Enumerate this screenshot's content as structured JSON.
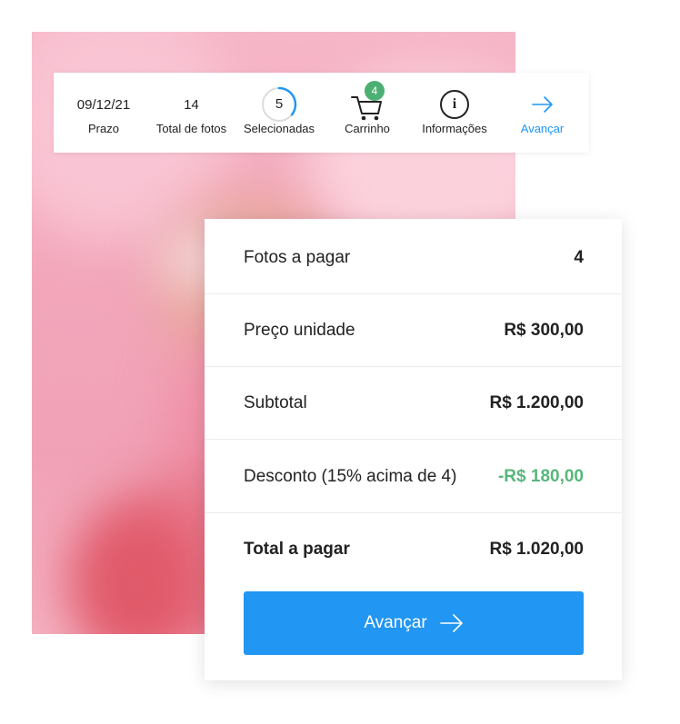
{
  "toolbar": {
    "deadline": {
      "value": "09/12/21",
      "label": "Prazo"
    },
    "total_photos": {
      "value": "14",
      "label": "Total de fotos"
    },
    "selected": {
      "value": "5",
      "label": "Selecionadas",
      "progress": 0.357
    },
    "cart": {
      "count": "4",
      "label": "Carrinho"
    },
    "info": {
      "label": "Informações",
      "icon": "info-icon"
    },
    "advance": {
      "label": "Avançar",
      "icon": "arrow-right-icon"
    }
  },
  "summary": {
    "rows": [
      {
        "label": "Fotos a pagar",
        "value": "4"
      },
      {
        "label": "Preço unidade",
        "value": "R$ 300,00"
      },
      {
        "label": "Subtotal",
        "value": "R$ 1.200,00"
      },
      {
        "label": "Desconto (15% acima de 4)",
        "value": "-R$ 180,00"
      },
      {
        "label": "Total a pagar",
        "value": "R$ 1.020,00"
      }
    ],
    "button_label": "Avançar"
  },
  "colors": {
    "accent": "#2196f3",
    "discount_green": "#57b77b",
    "badge_green": "#4caf73",
    "photo_pink": "#f3a7bb"
  }
}
